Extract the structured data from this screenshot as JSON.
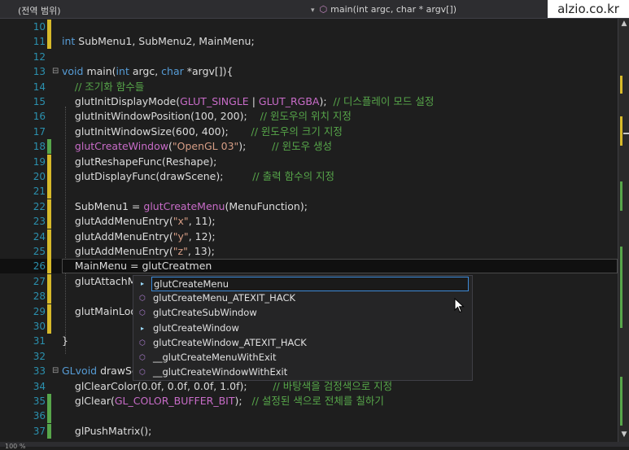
{
  "navbar": {
    "scope": "(전역 범위)",
    "function": "main(int argc, char * argv[])"
  },
  "watermark": "alzio.co.kr",
  "zoom": "100 %",
  "autocomplete": {
    "items": [
      {
        "icon": "macro-icon",
        "label": "glutCreateMenu",
        "selected": true
      },
      {
        "icon": "function-icon",
        "label": "glutCreateMenu_ATEXIT_HACK"
      },
      {
        "icon": "function-icon",
        "label": "glutCreateSubWindow"
      },
      {
        "icon": "macro-icon",
        "label": "glutCreateWindow"
      },
      {
        "icon": "function-icon",
        "label": "glutCreateWindow_ATEXIT_HACK"
      },
      {
        "icon": "function-icon",
        "label": "__glutCreateMenuWithExit"
      },
      {
        "icon": "function-icon",
        "label": "__glutCreateWindowWithExit"
      }
    ]
  },
  "colors": {
    "background": "#1e1e1e",
    "keyword": "#569cd6",
    "comment": "#57a64a",
    "string": "#d69d85",
    "macro": "#c86cc8",
    "line_number": "#2b91af"
  },
  "lines": [
    {
      "num": "10",
      "change": "yellow",
      "tokens": [
        {
          "t": ""
        }
      ]
    },
    {
      "num": "11",
      "change": "yellow",
      "tokens": [
        {
          "t": "int ",
          "c": "kw"
        },
        {
          "t": "SubMenu1, SubMenu2, MainMenu;"
        }
      ]
    },
    {
      "num": "12",
      "change": "",
      "tokens": [
        {
          "t": ""
        }
      ]
    },
    {
      "num": "13",
      "change": "",
      "fold": "⊟",
      "tokens": [
        {
          "t": "void ",
          "c": "kw"
        },
        {
          "t": "main("
        },
        {
          "t": "int ",
          "c": "kw"
        },
        {
          "t": "argc, "
        },
        {
          "t": "char ",
          "c": "kw"
        },
        {
          "t": "*argv[]){"
        }
      ]
    },
    {
      "num": "14",
      "change": "",
      "tokens": [
        {
          "t": "    "
        },
        {
          "t": "// 조기화 함수들",
          "c": "cm"
        }
      ]
    },
    {
      "num": "15",
      "change": "",
      "tokens": [
        {
          "t": "    glutInitDisplayMode("
        },
        {
          "t": "GLUT_SINGLE",
          "c": "mac"
        },
        {
          "t": " | "
        },
        {
          "t": "GLUT_RGBA",
          "c": "mac"
        },
        {
          "t": ");  "
        },
        {
          "t": "// 디스플레이 모드 설정",
          "c": "cm"
        }
      ]
    },
    {
      "num": "16",
      "change": "",
      "tokens": [
        {
          "t": "    glutInitWindowPosition(100, 200);    "
        },
        {
          "t": "// 윈도우의 위치 지정",
          "c": "cm"
        }
      ]
    },
    {
      "num": "17",
      "change": "",
      "tokens": [
        {
          "t": "    glutInitWindowSize(600, 400);       "
        },
        {
          "t": "// 윈도우의 크기 지정",
          "c": "cm"
        }
      ]
    },
    {
      "num": "18",
      "change": "green",
      "tokens": [
        {
          "t": "    "
        },
        {
          "t": "glutCreateWindow",
          "c": "mac"
        },
        {
          "t": "("
        },
        {
          "t": "\"OpenGL 03\"",
          "c": "st"
        },
        {
          "t": ");        "
        },
        {
          "t": "// 윈도우 생성",
          "c": "cm"
        }
      ]
    },
    {
      "num": "19",
      "change": "yellow",
      "tokens": [
        {
          "t": "    glutReshapeFunc(Reshape);"
        }
      ]
    },
    {
      "num": "20",
      "change": "yellow",
      "tokens": [
        {
          "t": "    glutDisplayFunc(drawScene);         "
        },
        {
          "t": "// 출력 함수의 지정",
          "c": "cm"
        }
      ]
    },
    {
      "num": "21",
      "change": "yellow",
      "tokens": [
        {
          "t": ""
        }
      ]
    },
    {
      "num": "22",
      "change": "yellow",
      "tokens": [
        {
          "t": "    SubMenu1 = "
        },
        {
          "t": "glutCreateMenu",
          "c": "mac"
        },
        {
          "t": "(MenuFunction);"
        }
      ]
    },
    {
      "num": "23",
      "change": "yellow",
      "tokens": [
        {
          "t": "    glutAddMenuEntry("
        },
        {
          "t": "\"x\"",
          "c": "st"
        },
        {
          "t": ", 11);"
        }
      ]
    },
    {
      "num": "24",
      "change": "yellow",
      "tokens": [
        {
          "t": "    glutAddMenuEntry("
        },
        {
          "t": "\"y\"",
          "c": "st"
        },
        {
          "t": ", 12);"
        }
      ]
    },
    {
      "num": "25",
      "change": "yellow",
      "tokens": [
        {
          "t": "    glutAddMenuEntry("
        },
        {
          "t": "\"z\"",
          "c": "st"
        },
        {
          "t": ", 13);"
        }
      ]
    },
    {
      "num": "26",
      "change": "yellow",
      "current": true,
      "tokens": [
        {
          "t": "    MainMenu = glutCreatmen"
        }
      ]
    },
    {
      "num": "27",
      "change": "yellow",
      "tokens": [
        {
          "t": "    glutAttachMe"
        }
      ]
    },
    {
      "num": "28",
      "change": "yellow",
      "tokens": [
        {
          "t": ""
        }
      ]
    },
    {
      "num": "29",
      "change": "yellow",
      "tokens": [
        {
          "t": "    glutMainLoop"
        }
      ]
    },
    {
      "num": "30",
      "change": "yellow",
      "tokens": [
        {
          "t": ""
        }
      ]
    },
    {
      "num": "31",
      "change": "",
      "tokens": [
        {
          "t": "}"
        }
      ]
    },
    {
      "num": "32",
      "change": "",
      "tokens": [
        {
          "t": ""
        }
      ]
    },
    {
      "num": "33",
      "change": "",
      "fold": "⊟",
      "tokens": [
        {
          "t": "GLvoid ",
          "c": "kw"
        },
        {
          "t": "drawSce"
        }
      ]
    },
    {
      "num": "34",
      "change": "",
      "tokens": [
        {
          "t": "    glClearColor(0.0f, 0.0f, 0.0f, 1.0f);        "
        },
        {
          "t": "// 바탕색을 검정색으로 지정",
          "c": "cm"
        }
      ]
    },
    {
      "num": "35",
      "change": "green",
      "tokens": [
        {
          "t": "    glClear("
        },
        {
          "t": "GL_COLOR_BUFFER_BIT",
          "c": "mac"
        },
        {
          "t": ");   "
        },
        {
          "t": "// 설정된 색으로 전체를 칠하기",
          "c": "cm"
        }
      ]
    },
    {
      "num": "36",
      "change": "green",
      "tokens": [
        {
          "t": ""
        }
      ]
    },
    {
      "num": "37",
      "change": "green",
      "tokens": [
        {
          "t": "    glPushMatrix();"
        }
      ]
    }
  ]
}
